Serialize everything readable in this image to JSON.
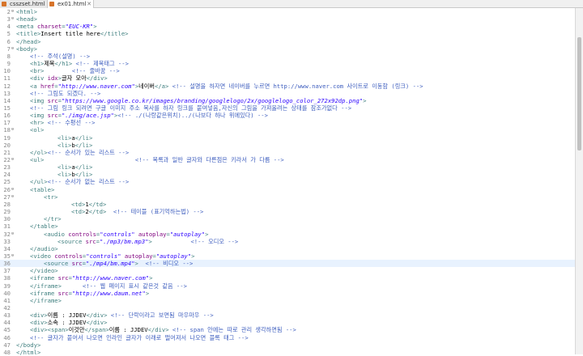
{
  "tabs": [
    {
      "label": "csszset.html",
      "active": false
    },
    {
      "label": "ex01.html",
      "active": true
    }
  ],
  "editor": {
    "current_line": 36,
    "lines": [
      {
        "n": "2",
        "fold": "⊖",
        "ind": 0,
        "seg": [
          [
            "t",
            "<html>"
          ]
        ]
      },
      {
        "n": "3",
        "fold": "⊖",
        "ind": 0,
        "seg": [
          [
            "t",
            "<head>"
          ]
        ]
      },
      {
        "n": "4",
        "fold": "",
        "ind": 0,
        "seg": [
          [
            "t",
            "<meta "
          ],
          [
            "a",
            "charset"
          ],
          [
            "t",
            "="
          ],
          [
            "v",
            "\"EUC-KR\""
          ],
          [
            "t",
            ">"
          ]
        ]
      },
      {
        "n": "5",
        "fold": "",
        "ind": 0,
        "seg": [
          [
            "t",
            "<title>"
          ],
          [
            "",
            "Insert title here"
          ],
          [
            "t",
            "</title>"
          ]
        ]
      },
      {
        "n": "6",
        "fold": "",
        "ind": 0,
        "seg": [
          [
            "t",
            "</head>"
          ]
        ]
      },
      {
        "n": "7",
        "fold": "⊖",
        "ind": 0,
        "seg": [
          [
            "t",
            "<body>"
          ]
        ]
      },
      {
        "n": "8",
        "fold": "",
        "ind": 17,
        "seg": [
          [
            "c",
            "<!-- 주석(설명) -->"
          ]
        ]
      },
      {
        "n": "9",
        "fold": "",
        "ind": 17,
        "seg": [
          [
            "t",
            "<h1>"
          ],
          [
            "",
            "제목"
          ],
          [
            "t",
            "</h1>"
          ],
          [
            "c",
            " <!-- 제목태그 -->"
          ]
        ]
      },
      {
        "n": "10",
        "fold": "",
        "ind": 17,
        "seg": [
          [
            "t",
            "<br>"
          ],
          [
            "c",
            "        <!-- 줄바꿈 -->"
          ]
        ]
      },
      {
        "n": "11",
        "fold": "",
        "ind": 17,
        "seg": [
          [
            "t",
            "<div "
          ],
          [
            "a",
            "idx"
          ],
          [
            "t",
            ">"
          ],
          [
            "",
            "글자 모아"
          ],
          [
            "t",
            "</div>"
          ]
        ]
      },
      {
        "n": "12",
        "fold": "",
        "ind": 17,
        "seg": [
          [
            "t",
            "<a "
          ],
          [
            "a",
            "href"
          ],
          [
            "t",
            "="
          ],
          [
            "v",
            "\"http://www.naver.com\""
          ],
          [
            "t",
            ">"
          ],
          [
            "",
            "네이버"
          ],
          [
            "t",
            "</a>"
          ],
          [
            "c",
            " <!-- 설명을 하자면 네이버를 누르면 http://www.naver.com 사이트로 이동함 (링크) -->"
          ]
        ]
      },
      {
        "n": "13",
        "fold": "",
        "ind": 17,
        "seg": [
          [
            "c",
            "<!-- 그림도 되겠다. -->"
          ]
        ]
      },
      {
        "n": "14",
        "fold": "",
        "ind": 17,
        "seg": [
          [
            "t",
            "<img "
          ],
          [
            "a",
            "src"
          ],
          [
            "t",
            "="
          ],
          [
            "v",
            "\"https://www.google.co.kr/images/branding/googlelogo/2x/googlelogo_color_272x92dp.png\""
          ],
          [
            "t",
            ">"
          ]
        ]
      },
      {
        "n": "15",
        "fold": "",
        "ind": 17,
        "seg": [
          [
            "c",
            "<!-- 그림 링크 되려면 구글 이미지 주소 복사를 하자 링크를 붙여넣음,자신의 그림을 가져올려는 상태를 참조가없다 -->"
          ]
        ]
      },
      {
        "n": "16",
        "fold": "",
        "ind": 17,
        "seg": [
          [
            "t",
            "<img "
          ],
          [
            "a",
            "src"
          ],
          [
            "t",
            "="
          ],
          [
            "v",
            "\"./img/ace.jsp\""
          ],
          [
            "t",
            ">"
          ],
          [
            "c",
            "<!-- ./(나랑같은위치)../(나보다 하나 위에있다) -->"
          ]
        ]
      },
      {
        "n": "17",
        "fold": "",
        "ind": 17,
        "seg": [
          [
            "t",
            "<hr>"
          ],
          [
            "c",
            " <!-- 수평선 -->"
          ]
        ]
      },
      {
        "n": "18",
        "fold": "⊖",
        "ind": 17,
        "seg": [
          [
            "t",
            "<ol>"
          ]
        ]
      },
      {
        "n": "19",
        "fold": "",
        "ind": 51,
        "seg": [
          [
            "t",
            "<li>"
          ],
          [
            "",
            "a"
          ],
          [
            "t",
            "</li>"
          ]
        ]
      },
      {
        "n": "20",
        "fold": "",
        "ind": 51,
        "seg": [
          [
            "t",
            "<li>"
          ],
          [
            "",
            "b"
          ],
          [
            "t",
            "</li>"
          ]
        ]
      },
      {
        "n": "21",
        "fold": "",
        "ind": 17,
        "seg": [
          [
            "t",
            "</ol>"
          ],
          [
            "c",
            "<!-- 순서가 있는 리스트 -->"
          ]
        ]
      },
      {
        "n": "22",
        "fold": "⊖",
        "ind": 17,
        "seg": [
          [
            "t",
            "<ul>"
          ],
          [
            "c",
            "                          <!-- 목록과 일반 글자와 다른점은 키라서 가 다름 -->"
          ]
        ]
      },
      {
        "n": "23",
        "fold": "",
        "ind": 51,
        "seg": [
          [
            "t",
            "<li>"
          ],
          [
            "",
            "a"
          ],
          [
            "t",
            "</li>"
          ]
        ]
      },
      {
        "n": "24",
        "fold": "",
        "ind": 51,
        "seg": [
          [
            "t",
            "<li>"
          ],
          [
            "",
            "b"
          ],
          [
            "t",
            "</li>"
          ]
        ]
      },
      {
        "n": "25",
        "fold": "",
        "ind": 17,
        "seg": [
          [
            "t",
            "</ul>"
          ],
          [
            "c",
            "<!-- 순서가 없는 리스트 -->"
          ]
        ]
      },
      {
        "n": "26",
        "fold": "⊖",
        "ind": 17,
        "seg": [
          [
            "t",
            "<table>"
          ]
        ]
      },
      {
        "n": "27",
        "fold": "⊖",
        "ind": 34,
        "seg": [
          [
            "t",
            "<tr>"
          ]
        ]
      },
      {
        "n": "28",
        "fold": "",
        "ind": 68,
        "seg": [
          [
            "t",
            "<td>"
          ],
          [
            "",
            "1"
          ],
          [
            "t",
            "</td>"
          ]
        ]
      },
      {
        "n": "29",
        "fold": "",
        "ind": 68,
        "seg": [
          [
            "t",
            "<td>"
          ],
          [
            "",
            "2"
          ],
          [
            "t",
            "</td>"
          ],
          [
            "c",
            "  <!-- 테이블 (표기억하는법) -->"
          ]
        ]
      },
      {
        "n": "30",
        "fold": "",
        "ind": 34,
        "seg": [
          [
            "t",
            "</tr>"
          ]
        ]
      },
      {
        "n": "31",
        "fold": "",
        "ind": 17,
        "seg": [
          [
            "t",
            "</table>"
          ]
        ]
      },
      {
        "n": "32",
        "fold": "⊖",
        "ind": 34,
        "seg": [
          [
            "t",
            "<audio "
          ],
          [
            "a",
            "controls"
          ],
          [
            "t",
            "="
          ],
          [
            "v",
            "\"controls\""
          ],
          [
            "t",
            " "
          ],
          [
            "a",
            "autoplay"
          ],
          [
            "t",
            "="
          ],
          [
            "v",
            "\"autoplay\""
          ],
          [
            "t",
            ">"
          ]
        ]
      },
      {
        "n": "33",
        "fold": "",
        "ind": 51,
        "seg": [
          [
            "t",
            "<source "
          ],
          [
            "a",
            "src"
          ],
          [
            "t",
            "="
          ],
          [
            "v",
            "\"./mp3/bm.mp3\""
          ],
          [
            "t",
            ">"
          ],
          [
            "c",
            "           <!-- 오디오 -->"
          ]
        ]
      },
      {
        "n": "34",
        "fold": "",
        "ind": 17,
        "seg": [
          [
            "t",
            "</audio>"
          ]
        ]
      },
      {
        "n": "35",
        "fold": "⊖",
        "ind": 17,
        "seg": [
          [
            "t",
            "<video "
          ],
          [
            "a",
            "controls"
          ],
          [
            "t",
            "="
          ],
          [
            "v",
            "\"controls\""
          ],
          [
            "t",
            " "
          ],
          [
            "a",
            "autoplay"
          ],
          [
            "t",
            "="
          ],
          [
            "v",
            "\"autoplay\""
          ],
          [
            "t",
            ">"
          ]
        ]
      },
      {
        "n": "36",
        "fold": "",
        "ind": 34,
        "seg": [
          [
            "t",
            "<source "
          ],
          [
            "a",
            "src"
          ],
          [
            "t",
            "="
          ],
          [
            "v",
            "\"./mp4/bm.mp4\""
          ],
          [
            "t",
            ">"
          ],
          [
            "c",
            "  <!-- 비디오 -->"
          ]
        ]
      },
      {
        "n": "37",
        "fold": "",
        "ind": 17,
        "seg": [
          [
            "t",
            "</video>"
          ]
        ]
      },
      {
        "n": "38",
        "fold": "",
        "ind": 17,
        "seg": [
          [
            "t",
            "<iframe "
          ],
          [
            "a",
            "src"
          ],
          [
            "t",
            "="
          ],
          [
            "v",
            "\"http://www.naver.com\""
          ],
          [
            "t",
            ">"
          ]
        ]
      },
      {
        "n": "39",
        "fold": "",
        "ind": 17,
        "seg": [
          [
            "t",
            "</iframe>"
          ],
          [
            "c",
            "      <!-- 웹 페이지 표시 같은것 같음 -->"
          ]
        ]
      },
      {
        "n": "40",
        "fold": "",
        "ind": 17,
        "seg": [
          [
            "t",
            "<iframe "
          ],
          [
            "a",
            "src"
          ],
          [
            "t",
            "="
          ],
          [
            "v",
            "\"http://www.daum.net\""
          ],
          [
            "t",
            ">"
          ]
        ]
      },
      {
        "n": "41",
        "fold": "",
        "ind": 17,
        "seg": [
          [
            "t",
            "</iframe>"
          ]
        ]
      },
      {
        "n": "42",
        "fold": "",
        "ind": 0,
        "seg": []
      },
      {
        "n": "43",
        "fold": "",
        "ind": 17,
        "seg": [
          [
            "t",
            "<div>"
          ],
          [
            "",
            "이름 : JJDEV"
          ],
          [
            "t",
            "</div>"
          ],
          [
            "c",
            " <!-- 단락이라고 보면됨 마우마우 -->"
          ]
        ]
      },
      {
        "n": "44",
        "fold": "",
        "ind": 17,
        "seg": [
          [
            "t",
            "<div>"
          ],
          [
            "",
            "소속 : JJDEV"
          ],
          [
            "t",
            "</div>"
          ]
        ]
      },
      {
        "n": "45",
        "fold": "",
        "ind": 17,
        "seg": [
          [
            "t",
            "<div><span>"
          ],
          [
            "",
            "이것만"
          ],
          [
            "t",
            "</span>"
          ],
          [
            "",
            "이름 : JJDEV"
          ],
          [
            "t",
            "</div>"
          ],
          [
            "c",
            " <!-- span 안에는 따로 관리 생각하면됨 -->"
          ]
        ]
      },
      {
        "n": "46",
        "fold": "",
        "ind": 17,
        "seg": [
          [
            "c",
            "<!-- 글자가 붙어서 나오면 인라인 글자가 이래로 떨어져서 나오면 블록 태그 -->"
          ]
        ]
      },
      {
        "n": "47",
        "fold": "",
        "ind": 0,
        "seg": [
          [
            "t",
            "</body>"
          ]
        ]
      },
      {
        "n": "48",
        "fold": "",
        "ind": 0,
        "seg": [
          [
            "t",
            "</html>"
          ]
        ]
      }
    ]
  },
  "colors": {
    "tag": "#3f7f7f",
    "attr": "#7f007f",
    "value": "#2a00ff",
    "comment": "#3f5fbf",
    "current_line": "#e8f2fe"
  }
}
